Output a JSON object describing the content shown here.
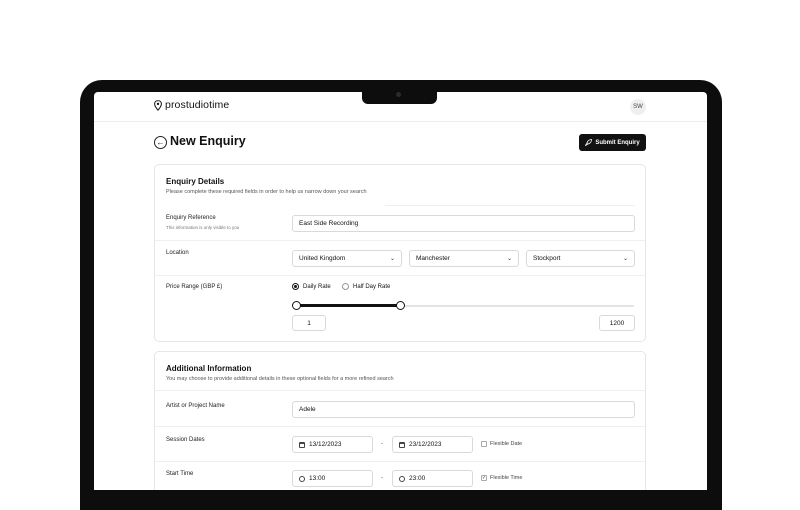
{
  "header": {
    "logo_text": "prostudiotime",
    "avatar_initials": "SW"
  },
  "page": {
    "title": "New Enquiry",
    "submit_label": "Submit Enquiry"
  },
  "enquiry_details": {
    "title": "Enquiry Details",
    "subtitle": "Please complete these required fields in order to help us narrow down your search",
    "reference": {
      "label": "Enquiry Reference",
      "hint": "This information is only visible to you",
      "value": "East Side Recording"
    },
    "location": {
      "label": "Location",
      "country": "United Kingdom",
      "city": "Manchester",
      "area": "Stockport"
    },
    "price": {
      "label": "Price Range (GBP £)",
      "options": [
        "Daily Rate",
        "Half Day Rate"
      ],
      "selected": "Daily Rate",
      "min_value": "1",
      "max_value": "1200",
      "range_fill_fraction": 0.31
    }
  },
  "additional_info": {
    "title": "Additional Information",
    "subtitle": "You may choose to provide additional details in these optional fields for a more refined search",
    "artist": {
      "label": "Artist or Project Name",
      "value": "Adele"
    },
    "session_dates": {
      "label": "Session Dates",
      "start": "13/12/2023",
      "separator": "-",
      "end": "23/12/2023",
      "flexible_label": "Flexible Date",
      "flexible_checked": false
    },
    "start_time": {
      "label": "Start Time",
      "start": "13:00",
      "separator": "-",
      "end": "23:00",
      "flexible_label": "Flexible Time",
      "flexible_checked": true
    }
  },
  "icons": {
    "back": "arrow-left-circle-icon",
    "submit": "rocket-icon",
    "logo": "map-pin-icon",
    "select": "chevron-down-icon",
    "date": "calendar-icon",
    "time": "clock-icon"
  },
  "colors": {
    "primary": "#111111",
    "background": "#ffffff",
    "border": "#d9d9d9",
    "device_frame": "#0d0d0d"
  }
}
